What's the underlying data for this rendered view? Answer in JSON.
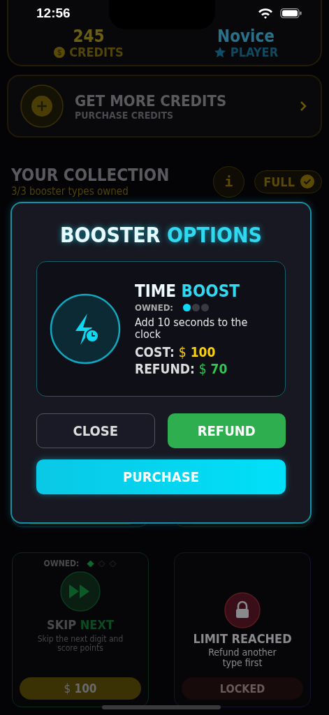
{
  "status_bar": {
    "time": "12:56"
  },
  "stats": {
    "coin_symbol": "$",
    "credits_value": "245",
    "credits_label": "CREDITS",
    "rank": "Novice",
    "rank_label": "PLAYER"
  },
  "get_credits": {
    "title": "GET MORE CREDITS",
    "subtitle": "PURCHASE CREDITS"
  },
  "collection": {
    "title": "YOUR COLLECTION",
    "subtitle": "3/3 booster types owned",
    "info": "i",
    "badge": "FULL"
  },
  "modal": {
    "title_part1": "BOOSTER",
    "title_part2": "OPTIONS",
    "name_part1": "TIME",
    "name_part2": "BOOST",
    "owned_label": "OWNED:",
    "owned": [
      {
        "filled": true
      },
      {
        "filled": false
      },
      {
        "filled": false
      }
    ],
    "description": "Add 10 seconds to the clock",
    "cost_label": "COST:",
    "cost_currency": "$",
    "cost": "100",
    "refund_label": "REFUND:",
    "refund_currency": "$",
    "refund": "70",
    "buttons": [
      {
        "kind": "close",
        "label": "CLOSE"
      },
      {
        "kind": "refund",
        "label": "REFUND"
      },
      {
        "kind": "purchase",
        "label": "PURCHASE"
      }
    ]
  },
  "boosters": [
    {
      "kind": "available",
      "owned_label": "OWNED:",
      "owned": [
        {
          "filled": true
        },
        {
          "filled": false
        },
        {
          "filled": false
        }
      ],
      "name_part1": "SKIP",
      "name_part2": "NEXT",
      "description": "Skip the next digit and score points",
      "price_currency": "$",
      "price": "100"
    },
    {
      "kind": "locked",
      "title": "LIMIT REACHED",
      "message": "Refund another type first",
      "button": "LOCKED"
    }
  ]
}
